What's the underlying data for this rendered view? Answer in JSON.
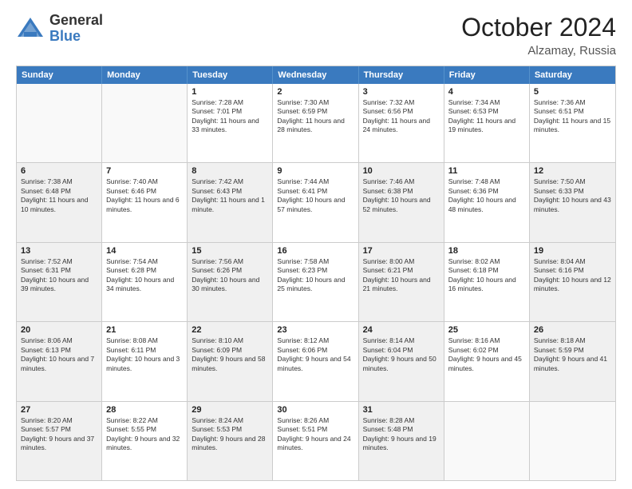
{
  "header": {
    "logo_general": "General",
    "logo_blue": "Blue",
    "month_title": "October 2024",
    "location": "Alzamay, Russia"
  },
  "days_of_week": [
    "Sunday",
    "Monday",
    "Tuesday",
    "Wednesday",
    "Thursday",
    "Friday",
    "Saturday"
  ],
  "weeks": [
    [
      {
        "day": "",
        "sunrise": "",
        "sunset": "",
        "daylight": "",
        "empty": true
      },
      {
        "day": "",
        "sunrise": "",
        "sunset": "",
        "daylight": "",
        "empty": true
      },
      {
        "day": "1",
        "sunrise": "Sunrise: 7:28 AM",
        "sunset": "Sunset: 7:01 PM",
        "daylight": "Daylight: 11 hours and 33 minutes."
      },
      {
        "day": "2",
        "sunrise": "Sunrise: 7:30 AM",
        "sunset": "Sunset: 6:59 PM",
        "daylight": "Daylight: 11 hours and 28 minutes."
      },
      {
        "day": "3",
        "sunrise": "Sunrise: 7:32 AM",
        "sunset": "Sunset: 6:56 PM",
        "daylight": "Daylight: 11 hours and 24 minutes."
      },
      {
        "day": "4",
        "sunrise": "Sunrise: 7:34 AM",
        "sunset": "Sunset: 6:53 PM",
        "daylight": "Daylight: 11 hours and 19 minutes."
      },
      {
        "day": "5",
        "sunrise": "Sunrise: 7:36 AM",
        "sunset": "Sunset: 6:51 PM",
        "daylight": "Daylight: 11 hours and 15 minutes."
      }
    ],
    [
      {
        "day": "6",
        "sunrise": "Sunrise: 7:38 AM",
        "sunset": "Sunset: 6:48 PM",
        "daylight": "Daylight: 11 hours and 10 minutes.",
        "shaded": true
      },
      {
        "day": "7",
        "sunrise": "Sunrise: 7:40 AM",
        "sunset": "Sunset: 6:46 PM",
        "daylight": "Daylight: 11 hours and 6 minutes."
      },
      {
        "day": "8",
        "sunrise": "Sunrise: 7:42 AM",
        "sunset": "Sunset: 6:43 PM",
        "daylight": "Daylight: 11 hours and 1 minute.",
        "shaded": true
      },
      {
        "day": "9",
        "sunrise": "Sunrise: 7:44 AM",
        "sunset": "Sunset: 6:41 PM",
        "daylight": "Daylight: 10 hours and 57 minutes."
      },
      {
        "day": "10",
        "sunrise": "Sunrise: 7:46 AM",
        "sunset": "Sunset: 6:38 PM",
        "daylight": "Daylight: 10 hours and 52 minutes.",
        "shaded": true
      },
      {
        "day": "11",
        "sunrise": "Sunrise: 7:48 AM",
        "sunset": "Sunset: 6:36 PM",
        "daylight": "Daylight: 10 hours and 48 minutes."
      },
      {
        "day": "12",
        "sunrise": "Sunrise: 7:50 AM",
        "sunset": "Sunset: 6:33 PM",
        "daylight": "Daylight: 10 hours and 43 minutes.",
        "shaded": true
      }
    ],
    [
      {
        "day": "13",
        "sunrise": "Sunrise: 7:52 AM",
        "sunset": "Sunset: 6:31 PM",
        "daylight": "Daylight: 10 hours and 39 minutes.",
        "shaded": true
      },
      {
        "day": "14",
        "sunrise": "Sunrise: 7:54 AM",
        "sunset": "Sunset: 6:28 PM",
        "daylight": "Daylight: 10 hours and 34 minutes."
      },
      {
        "day": "15",
        "sunrise": "Sunrise: 7:56 AM",
        "sunset": "Sunset: 6:26 PM",
        "daylight": "Daylight: 10 hours and 30 minutes.",
        "shaded": true
      },
      {
        "day": "16",
        "sunrise": "Sunrise: 7:58 AM",
        "sunset": "Sunset: 6:23 PM",
        "daylight": "Daylight: 10 hours and 25 minutes."
      },
      {
        "day": "17",
        "sunrise": "Sunrise: 8:00 AM",
        "sunset": "Sunset: 6:21 PM",
        "daylight": "Daylight: 10 hours and 21 minutes.",
        "shaded": true
      },
      {
        "day": "18",
        "sunrise": "Sunrise: 8:02 AM",
        "sunset": "Sunset: 6:18 PM",
        "daylight": "Daylight: 10 hours and 16 minutes."
      },
      {
        "day": "19",
        "sunrise": "Sunrise: 8:04 AM",
        "sunset": "Sunset: 6:16 PM",
        "daylight": "Daylight: 10 hours and 12 minutes.",
        "shaded": true
      }
    ],
    [
      {
        "day": "20",
        "sunrise": "Sunrise: 8:06 AM",
        "sunset": "Sunset: 6:13 PM",
        "daylight": "Daylight: 10 hours and 7 minutes.",
        "shaded": true
      },
      {
        "day": "21",
        "sunrise": "Sunrise: 8:08 AM",
        "sunset": "Sunset: 6:11 PM",
        "daylight": "Daylight: 10 hours and 3 minutes."
      },
      {
        "day": "22",
        "sunrise": "Sunrise: 8:10 AM",
        "sunset": "Sunset: 6:09 PM",
        "daylight": "Daylight: 9 hours and 58 minutes.",
        "shaded": true
      },
      {
        "day": "23",
        "sunrise": "Sunrise: 8:12 AM",
        "sunset": "Sunset: 6:06 PM",
        "daylight": "Daylight: 9 hours and 54 minutes."
      },
      {
        "day": "24",
        "sunrise": "Sunrise: 8:14 AM",
        "sunset": "Sunset: 6:04 PM",
        "daylight": "Daylight: 9 hours and 50 minutes.",
        "shaded": true
      },
      {
        "day": "25",
        "sunrise": "Sunrise: 8:16 AM",
        "sunset": "Sunset: 6:02 PM",
        "daylight": "Daylight: 9 hours and 45 minutes."
      },
      {
        "day": "26",
        "sunrise": "Sunrise: 8:18 AM",
        "sunset": "Sunset: 5:59 PM",
        "daylight": "Daylight: 9 hours and 41 minutes.",
        "shaded": true
      }
    ],
    [
      {
        "day": "27",
        "sunrise": "Sunrise: 8:20 AM",
        "sunset": "Sunset: 5:57 PM",
        "daylight": "Daylight: 9 hours and 37 minutes.",
        "shaded": true
      },
      {
        "day": "28",
        "sunrise": "Sunrise: 8:22 AM",
        "sunset": "Sunset: 5:55 PM",
        "daylight": "Daylight: 9 hours and 32 minutes."
      },
      {
        "day": "29",
        "sunrise": "Sunrise: 8:24 AM",
        "sunset": "Sunset: 5:53 PM",
        "daylight": "Daylight: 9 hours and 28 minutes.",
        "shaded": true
      },
      {
        "day": "30",
        "sunrise": "Sunrise: 8:26 AM",
        "sunset": "Sunset: 5:51 PM",
        "daylight": "Daylight: 9 hours and 24 minutes."
      },
      {
        "day": "31",
        "sunrise": "Sunrise: 8:28 AM",
        "sunset": "Sunset: 5:48 PM",
        "daylight": "Daylight: 9 hours and 19 minutes.",
        "shaded": true
      },
      {
        "day": "",
        "sunrise": "",
        "sunset": "",
        "daylight": "",
        "empty": true
      },
      {
        "day": "",
        "sunrise": "",
        "sunset": "",
        "daylight": "",
        "empty": true
      }
    ]
  ]
}
